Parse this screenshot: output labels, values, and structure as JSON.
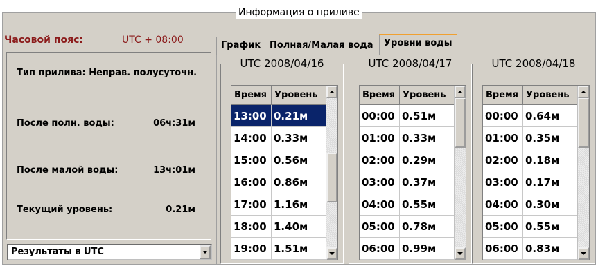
{
  "window_title": "Информация о приливе",
  "timezone": {
    "label": "Часовой пояс:",
    "value": "UTC + 08:00"
  },
  "info": {
    "tide_type": "Тип прилива: Неправ. полусуточн.",
    "after_high_label": "После полн. воды:",
    "after_high_value": "06ч:31м",
    "after_low_label": "После малой воды:",
    "after_low_value": "13ч:01м",
    "current_label": "Текущий уровень:",
    "current_value": "0.21м"
  },
  "results_select": {
    "value": "Результаты в UTC"
  },
  "tabs": [
    {
      "label": "График"
    },
    {
      "label": "Полная/Малая вода"
    },
    {
      "label": "Уровни воды",
      "active": true
    }
  ],
  "columns": {
    "time": "Время",
    "level": "Уровень"
  },
  "days": [
    {
      "title": "UTC 2008/04/16",
      "selected_index": 0,
      "scroll_position": 0.55,
      "rows": [
        {
          "time": "13:00",
          "level": "0.21м"
        },
        {
          "time": "14:00",
          "level": "0.33м"
        },
        {
          "time": "15:00",
          "level": "0.56м"
        },
        {
          "time": "16:00",
          "level": "0.86м"
        },
        {
          "time": "17:00",
          "level": "1.16м"
        },
        {
          "time": "18:00",
          "level": "1.40м"
        },
        {
          "time": "19:00",
          "level": "1.51м"
        }
      ]
    },
    {
      "title": "UTC 2008/04/17",
      "selected_index": -1,
      "scroll_position": 0.0,
      "rows": [
        {
          "time": "00:00",
          "level": "0.51м"
        },
        {
          "time": "01:00",
          "level": "0.33м"
        },
        {
          "time": "02:00",
          "level": "0.29м"
        },
        {
          "time": "03:00",
          "level": "0.37м"
        },
        {
          "time": "04:00",
          "level": "0.55м"
        },
        {
          "time": "05:00",
          "level": "0.78м"
        },
        {
          "time": "06:00",
          "level": "0.99м"
        }
      ]
    },
    {
      "title": "UTC 2008/04/18",
      "selected_index": -1,
      "scroll_position": 0.0,
      "rows": [
        {
          "time": "00:00",
          "level": "0.64м"
        },
        {
          "time": "01:00",
          "level": "0.35м"
        },
        {
          "time": "02:00",
          "level": "0.18м"
        },
        {
          "time": "03:00",
          "level": "0.17м"
        },
        {
          "time": "04:00",
          "level": "0.30м"
        },
        {
          "time": "05:00",
          "level": "0.55м"
        },
        {
          "time": "06:00",
          "level": "0.83м"
        }
      ]
    }
  ],
  "colors": {
    "timezone_text": "#8b1a1a",
    "selection_bg": "#0a246a",
    "active_tab_accent": "#f0a030"
  }
}
